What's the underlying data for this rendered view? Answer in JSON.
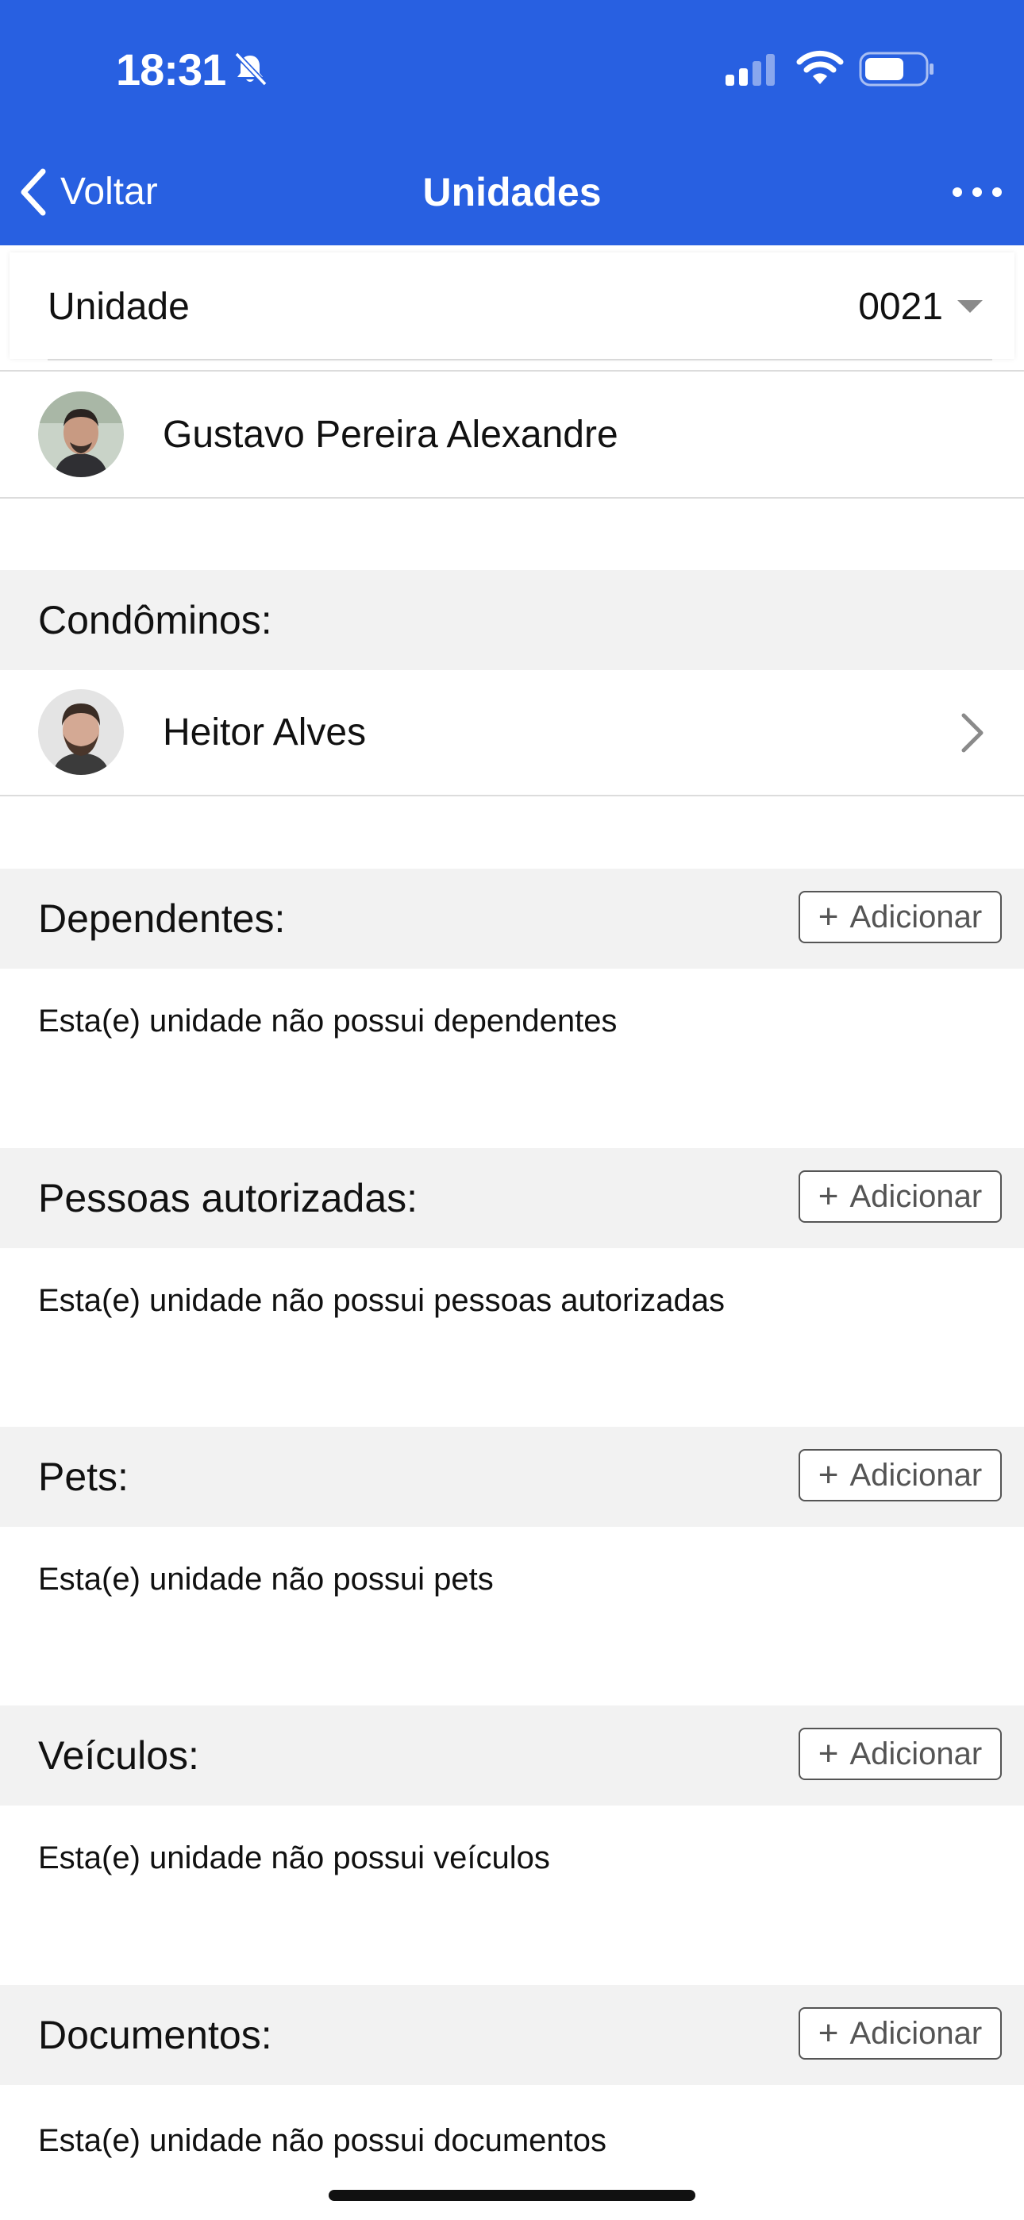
{
  "status_bar": {
    "time": "18:31",
    "icons": [
      "bell-slash-icon",
      "signal-icon",
      "wifi-icon",
      "battery-icon"
    ],
    "signal_bars_active": 2,
    "battery_level": 0.6
  },
  "nav": {
    "back_label": "Voltar",
    "title": "Unidades",
    "more_icon": "ellipsis-icon",
    "colors": {
      "background": "#2860e1",
      "text": "#ffffff"
    }
  },
  "unit_selector": {
    "label": "Unidade",
    "value": "0021"
  },
  "owner": {
    "name": "Gustavo Pereira Alexandre"
  },
  "sections": {
    "condominos": {
      "title": "Condôminos:",
      "items": [
        {
          "name": "Heitor Alves"
        }
      ]
    },
    "dependentes": {
      "title": "Dependentes:",
      "add_label": "Adicionar",
      "empty": "Esta(e) unidade não possui dependentes"
    },
    "autorizadas": {
      "title": "Pessoas autorizadas:",
      "add_label": "Adicionar",
      "empty": "Esta(e) unidade não possui pessoas autorizadas"
    },
    "pets": {
      "title": "Pets:",
      "add_label": "Adicionar",
      "empty": "Esta(e) unidade não possui pets"
    },
    "veiculos": {
      "title": "Veículos:",
      "add_label": "Adicionar",
      "empty": "Esta(e) unidade não possui veículos"
    },
    "documentos": {
      "title": "Documentos:",
      "add_label": "Adicionar",
      "empty": "Esta(e) unidade não possui documentos"
    }
  }
}
